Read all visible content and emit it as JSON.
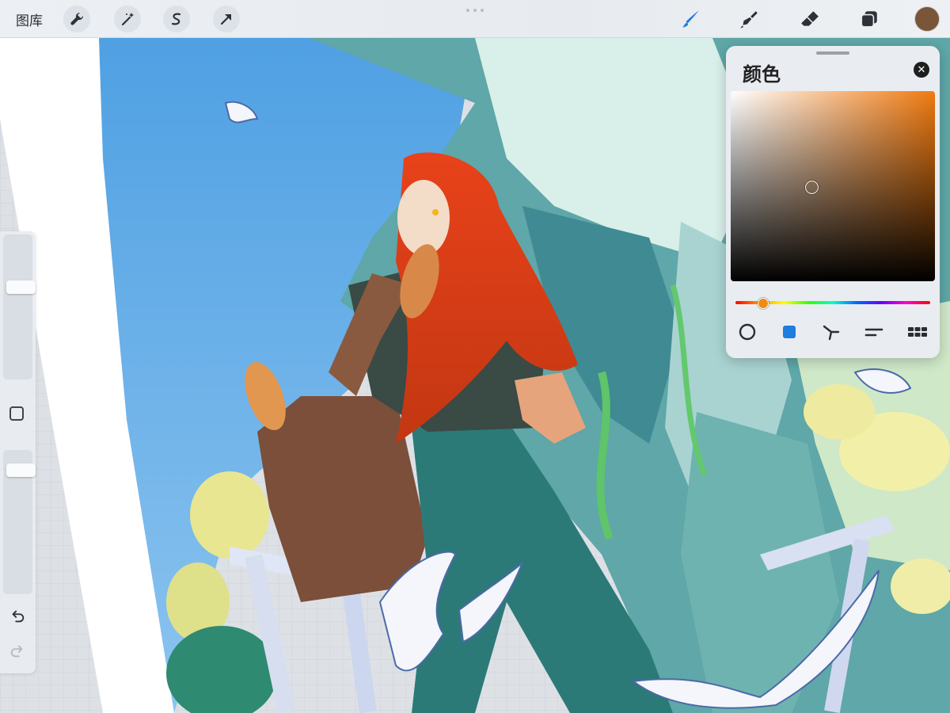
{
  "topbar": {
    "gallery_label": "图库",
    "left_tools": [
      "wrench-icon",
      "magic-wand-icon",
      "selection-icon",
      "transform-arrow-icon"
    ],
    "right_tools": [
      "brush-icon",
      "smudge-icon",
      "eraser-icon",
      "layers-icon"
    ],
    "active_tool": "brush-icon",
    "accent_color": "#1f7de0",
    "current_color": "#7a5538"
  },
  "sidebar": {
    "brush_size_level": 0.35,
    "opacity_level": 0.1
  },
  "color_panel": {
    "title": "颜色",
    "close_symbol": "✕",
    "hue_position": 0.14,
    "mode_tabs": [
      "disc-icon",
      "classic-square-icon",
      "harmony-icon",
      "value-sliders-icon",
      "palettes-icon"
    ],
    "active_mode": "classic-square-icon"
  }
}
